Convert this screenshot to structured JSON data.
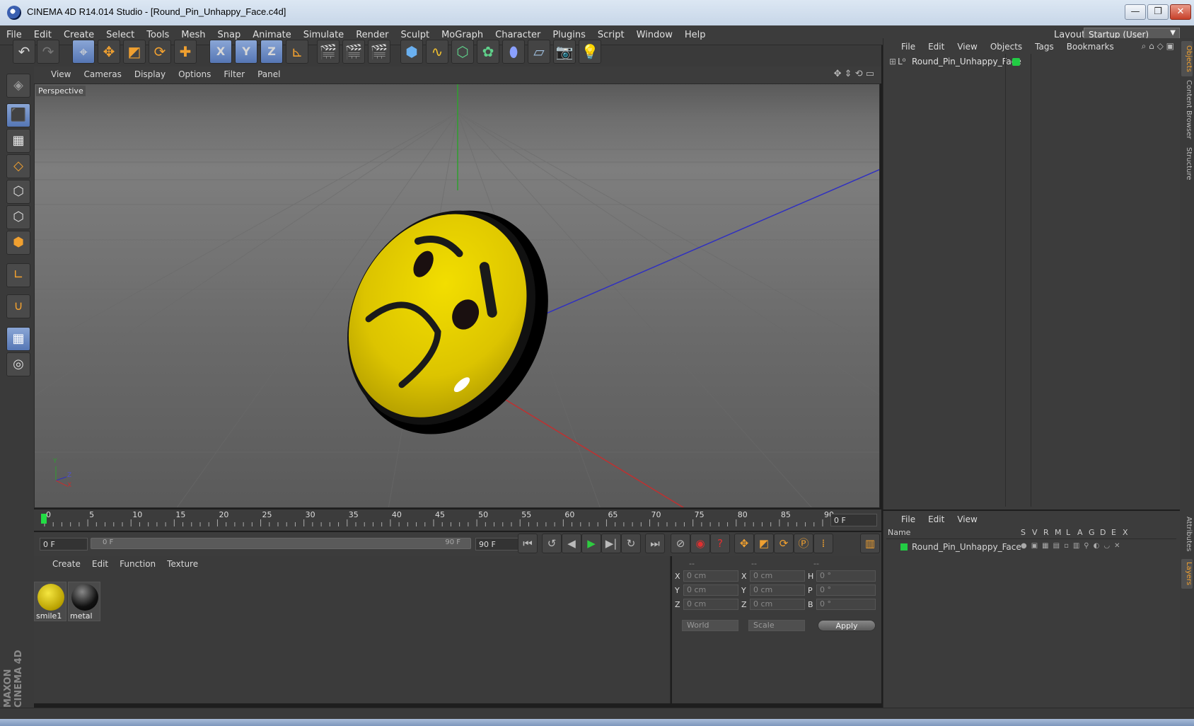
{
  "window": {
    "title": "CINEMA 4D R14.014 Studio - [Round_Pin_Unhappy_Face.c4d]",
    "buttons": {
      "minimize": "—",
      "restore": "❐",
      "close": "✕"
    }
  },
  "menubar": {
    "items": [
      "File",
      "Edit",
      "Create",
      "Select",
      "Tools",
      "Mesh",
      "Snap",
      "Animate",
      "Simulate",
      "Render",
      "Sculpt",
      "MoGraph",
      "Character",
      "Plugins",
      "Script",
      "Window",
      "Help"
    ],
    "layout_label": "Layout:",
    "layout_value": "Startup (User)"
  },
  "toolbar": {
    "axis_x": "X",
    "axis_y": "Y",
    "axis_z": "Z"
  },
  "viewport": {
    "menu": [
      "View",
      "Cameras",
      "Display",
      "Options",
      "Filter",
      "Panel"
    ],
    "label": "Perspective",
    "axis_y": "Y",
    "axis_z": "Z",
    "axis_x": "X"
  },
  "timeline": {
    "ticks": [
      "0",
      "5",
      "10",
      "15",
      "20",
      "25",
      "30",
      "35",
      "40",
      "45",
      "50",
      "55",
      "60",
      "65",
      "70",
      "75",
      "80",
      "85",
      "90"
    ],
    "current_frame": "0 F",
    "start_field": "0 F",
    "range_start": "0 F",
    "range_end": "90 F",
    "end_field": "90 F"
  },
  "materials": {
    "menu": [
      "Create",
      "Edit",
      "Function",
      "Texture"
    ],
    "items": [
      {
        "name": "smile1",
        "color": "#d9c300"
      },
      {
        "name": "metal",
        "color": "#222222"
      }
    ]
  },
  "coords": {
    "headers": [
      "--",
      "--",
      "--"
    ],
    "rows": [
      {
        "l1": "X",
        "v1": "0 cm",
        "l2": "X",
        "v2": "0 cm",
        "l3": "H",
        "v3": "0 °"
      },
      {
        "l1": "Y",
        "v1": "0 cm",
        "l2": "Y",
        "v2": "0 cm",
        "l3": "P",
        "v3": "0 °"
      },
      {
        "l1": "Z",
        "v1": "0 cm",
        "l2": "Z",
        "v2": "0 cm",
        "l3": "B",
        "v3": "0 °"
      }
    ],
    "mode": "World",
    "type": "Scale",
    "apply": "Apply"
  },
  "objects": {
    "menu": [
      "File",
      "Edit",
      "View",
      "Objects",
      "Tags",
      "Bookmarks"
    ],
    "items": [
      {
        "name": "Round_Pin_Unhappy_Face",
        "color": "#22cc44"
      }
    ]
  },
  "layers": {
    "menu": [
      "File",
      "Edit",
      "View"
    ],
    "columns": [
      "Name",
      "S",
      "V",
      "R",
      "M",
      "L",
      "A",
      "G",
      "D",
      "E",
      "X"
    ],
    "items": [
      {
        "name": "Round_Pin_Unhappy_Face",
        "color": "#22cc44"
      }
    ]
  },
  "sidetabs": [
    "Objects",
    "Content Browser",
    "Structure",
    "Attributes",
    "Layers"
  ],
  "branding": "MAXON CINEMA 4D",
  "colors": {
    "accent": "#f0a030",
    "selected": "#5576b4"
  }
}
